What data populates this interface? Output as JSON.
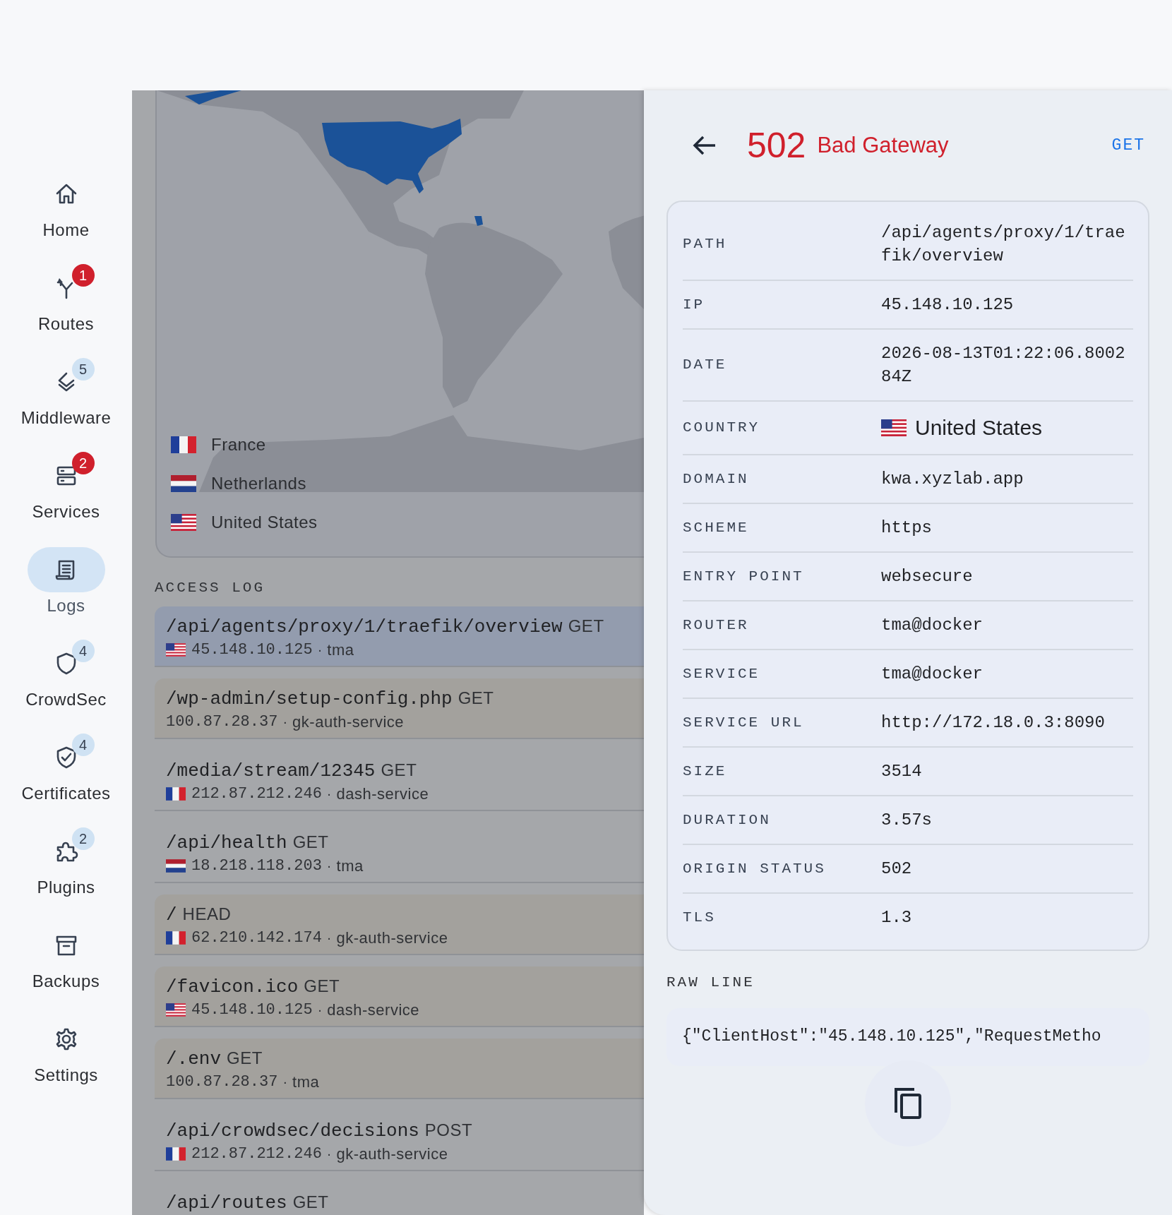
{
  "sidebar": {
    "items": [
      {
        "label": "Home",
        "selected": false
      },
      {
        "label": "Routes",
        "selected": false,
        "badge": {
          "text": "1",
          "color": "#d0202c"
        }
      },
      {
        "label": "Middleware",
        "selected": false,
        "badge": {
          "text": "5",
          "color": "#cfe2f3"
        }
      },
      {
        "label": "Services",
        "selected": false,
        "badge": {
          "text": "2",
          "color": "#d0202c"
        }
      },
      {
        "label": "Logs",
        "selected": true
      },
      {
        "label": "CrowdSec",
        "selected": false,
        "badge": {
          "text": "4",
          "color": "#cfe2f3"
        }
      },
      {
        "label": "Certificates",
        "selected": false,
        "badge": {
          "text": "4",
          "color": "#cfe2f3"
        }
      },
      {
        "label": "Plugins",
        "selected": false,
        "badge": {
          "text": "2",
          "color": "#cfe2f3"
        }
      },
      {
        "label": "Backups",
        "selected": false
      },
      {
        "label": "Settings",
        "selected": false
      }
    ]
  },
  "map": {
    "legend": [
      {
        "flag": {
          "kind": "fr"
        },
        "country": "France"
      },
      {
        "flag": {
          "kind": "nl"
        },
        "country": "Netherlands"
      },
      {
        "flag": {
          "kind": "us"
        },
        "country": "United States"
      }
    ]
  },
  "access_log": {
    "title": "ACCESS LOG",
    "rows": [
      {
        "path": "/api/agents/proxy/1/traefik/overview",
        "method": "GET",
        "flag": {
          "kind": "us"
        },
        "ip": "45.148.10.125",
        "separator": "·",
        "service": "tma",
        "selected": true,
        "highlighted": false
      },
      {
        "path": "/wp-admin/setup-config.php",
        "method": "GET",
        "ip": "100.87.28.37",
        "separator": "·",
        "service": "gk-auth-service",
        "selected": false,
        "highlighted": true
      },
      {
        "path": "/media/stream/12345",
        "method": "GET",
        "flag": {
          "kind": "fr"
        },
        "ip": "212.87.212.246",
        "separator": "·",
        "service": "dash-service",
        "selected": false,
        "highlighted": false
      },
      {
        "path": "/api/health",
        "method": "GET",
        "flag": {
          "kind": "nl"
        },
        "ip": "18.218.118.203",
        "separator": "·",
        "service": "tma",
        "selected": false,
        "highlighted": false
      },
      {
        "path": "/",
        "method": "HEAD",
        "flag": {
          "kind": "fr"
        },
        "ip": "62.210.142.174",
        "separator": "·",
        "service": "gk-auth-service",
        "selected": false,
        "highlighted": true
      },
      {
        "path": "/favicon.ico",
        "method": "GET",
        "flag": {
          "kind": "us"
        },
        "ip": "45.148.10.125",
        "separator": "·",
        "service": "dash-service",
        "selected": false,
        "highlighted": true
      },
      {
        "path": "/.env",
        "method": "GET",
        "ip": "100.87.28.37",
        "separator": "·",
        "service": "tma",
        "selected": false,
        "highlighted": true
      },
      {
        "path": "/api/crowdsec/decisions",
        "method": "POST",
        "flag": {
          "kind": "fr"
        },
        "ip": "212.87.212.246",
        "separator": "·",
        "service": "gk-auth-service",
        "selected": false,
        "highlighted": false
      },
      {
        "path": "/api/routes",
        "method": "GET",
        "selected": false,
        "highlighted": false
      }
    ]
  },
  "detail": {
    "status_code": "502",
    "status_text": "Bad Gateway",
    "method": "GET",
    "fields": [
      {
        "label": "PATH",
        "value": "/api/agents/proxy/1/traefik/overview"
      },
      {
        "label": "IP",
        "value": "45.148.10.125"
      },
      {
        "label": "DATE",
        "value": "2026-08-13T01:22:06.800284Z"
      },
      {
        "label": "COUNTRY",
        "value": "United States",
        "flag": {
          "kind": "us"
        }
      },
      {
        "label": "DOMAIN",
        "value": "kwa.xyzlab.app"
      },
      {
        "label": "SCHEME",
        "value": "https"
      },
      {
        "label": "ENTRY POINT",
        "value": "websecure"
      },
      {
        "label": "ROUTER",
        "value": "tma@docker"
      },
      {
        "label": "SERVICE",
        "value": "tma@docker"
      },
      {
        "label": "SERVICE URL",
        "value": "http://172.18.0.3:8090"
      },
      {
        "label": "SIZE",
        "value": "3514"
      },
      {
        "label": "DURATION",
        "value": "3.57s"
      },
      {
        "label": "ORIGIN STATUS",
        "value": "502"
      },
      {
        "label": "TLS",
        "value": "1.3"
      }
    ],
    "raw_line": {
      "title": "RAW LINE",
      "text": "{\"ClientHost\":\"45.148.10.125\",\"RequestMetho"
    }
  }
}
